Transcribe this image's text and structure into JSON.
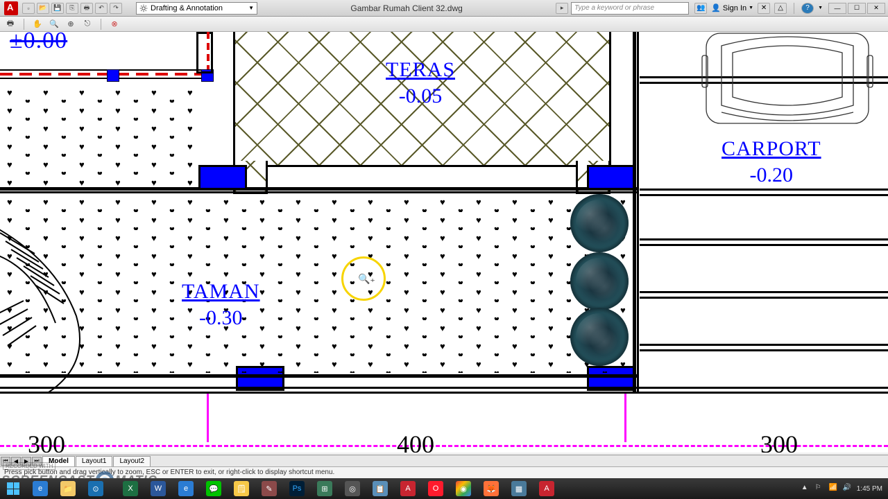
{
  "title": "Gambar Rumah Client 32.dwg",
  "workspace": "Drafting & Annotation",
  "search_placeholder": "Type a keyword or phrase",
  "signin": "Sign In",
  "coord": "±0.00",
  "rooms": {
    "teras": {
      "name": "TERAS",
      "val": "-0.05"
    },
    "taman": {
      "name": "TAMAN",
      "val": "-0.30"
    },
    "carport": {
      "name": "CARPORT",
      "val": "-0.20"
    }
  },
  "dims": {
    "d1": "300",
    "d2": "400",
    "d3": "300"
  },
  "tabs": {
    "model": "Model",
    "l1": "Layout1",
    "l2": "Layout2"
  },
  "cmd": "Press pick button and drag vertically to zoom, ESC or ENTER to exit, or right-click to display shortcut menu.",
  "watermark_a": "SCREENCAST",
  "watermark_b": "MATIC",
  "recorded": "RECORDED WITH",
  "clock": "1:45 PM"
}
